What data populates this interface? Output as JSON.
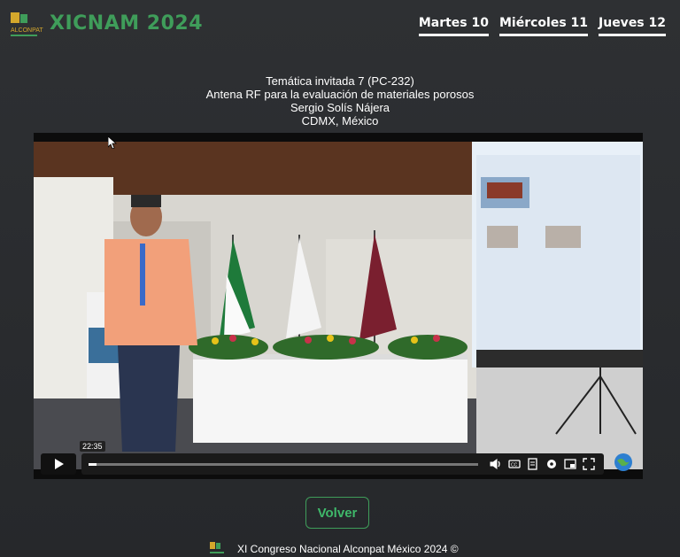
{
  "header": {
    "logo_text": "ALCONPAT",
    "title": "XICNAM 2024",
    "nav": [
      {
        "label": "Martes 10"
      },
      {
        "label": "Miércoles 11"
      },
      {
        "label": "Jueves 12"
      }
    ]
  },
  "talk": {
    "topic": "Temática invitada 7 (PC-232)",
    "title": "Antena RF para la evaluación de materiales porosos",
    "speaker": "Sergio Solís Nájera",
    "location": "CDMX, México"
  },
  "player": {
    "hover_time": "22:35",
    "progress": 0.02,
    "controls": [
      "volume-icon",
      "captions-icon",
      "transcript-icon",
      "settings-icon",
      "pip-icon",
      "fullscreen-icon"
    ]
  },
  "actions": {
    "back_label": "Volver"
  },
  "footer": {
    "text": "XI Congreso Nacional Alconpat México 2024 ©"
  },
  "colors": {
    "brand_green": "#3f9d5a",
    "background": "#2b2d30"
  }
}
